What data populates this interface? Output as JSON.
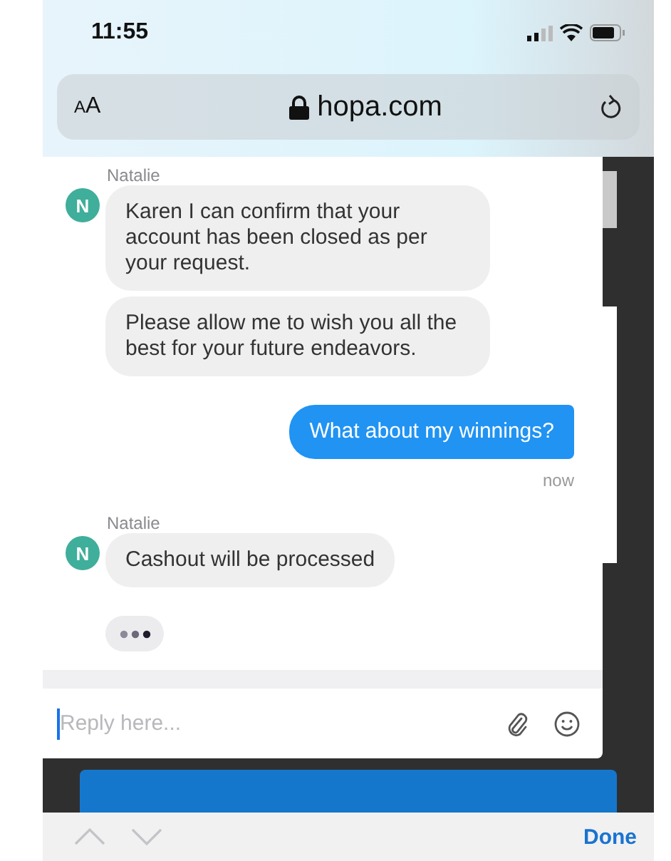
{
  "status_bar": {
    "time": "11:55"
  },
  "browser": {
    "text_size_label": "AA",
    "url": "hopa.com"
  },
  "chat": {
    "messages": [
      {
        "kind": "sender",
        "text": "Natalie"
      },
      {
        "kind": "agent",
        "text": "Karen I can confirm that your account has been closed as per your request.",
        "avatar": "N"
      },
      {
        "kind": "agent",
        "text": "Please allow me to wish you all the best for your future endeavors."
      },
      {
        "kind": "user",
        "text": "What about my winnings?"
      },
      {
        "kind": "time",
        "text": "now"
      },
      {
        "kind": "sender",
        "text": "Natalie"
      },
      {
        "kind": "agent",
        "text": "Cashout will be processed",
        "avatar": "N"
      },
      {
        "kind": "typing"
      }
    ],
    "reply": {
      "placeholder": "Reply here..."
    }
  },
  "keyboard_toolbar": {
    "done": "Done"
  }
}
